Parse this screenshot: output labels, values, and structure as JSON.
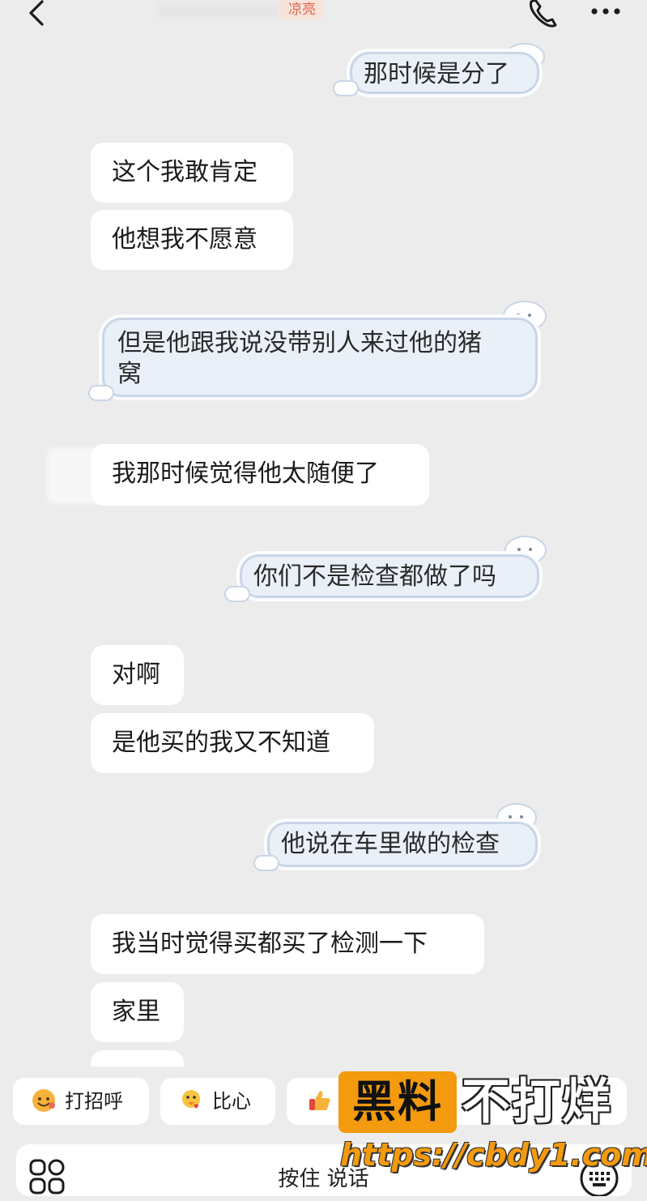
{
  "header": {
    "title_tag": "凉亮",
    "back_icon": "chevron-left-icon",
    "call_icon": "phone-icon",
    "more_icon": "more-dots-icon"
  },
  "messages": [
    {
      "side": "sent",
      "text": "那时候是分了"
    },
    {
      "side": "received",
      "text": "这个我敢肯定"
    },
    {
      "side": "received",
      "text": "他想我不愿意"
    },
    {
      "side": "sent",
      "text_line1": "但是他跟我说没带别人来过他的猪",
      "text_line2": "窝"
    },
    {
      "side": "received",
      "text": "我那时候觉得他太随便了"
    },
    {
      "side": "sent",
      "text": "你们不是检查都做了吗"
    },
    {
      "side": "received",
      "text": "对啊"
    },
    {
      "side": "received",
      "text": "是他买的我又不知道"
    },
    {
      "side": "sent",
      "text": "他说在车里做的检查"
    },
    {
      "side": "received",
      "text": "我当时觉得买都买了检测一下"
    },
    {
      "side": "received",
      "text": "家里"
    }
  ],
  "quick_replies": [
    {
      "label": "打招呼",
      "icon": "smile-emoji-icon"
    },
    {
      "label": "比心",
      "icon": "duck-heart-emoji-icon"
    },
    {
      "label": "",
      "icon": "thumbs-up-emoji-icon"
    }
  ],
  "input": {
    "hold_to_talk": "按住 说话",
    "apps_icon": "apps-grid-icon",
    "keyboard_icon": "keyboard-icon"
  },
  "watermark": {
    "box_text": "黑料",
    "text": "不打烊",
    "url": "https://cbdy1.com"
  },
  "colors": {
    "background": "#ececec",
    "received_bubble": "#ffffff",
    "sent_bubble": "#eaf0f8",
    "sent_border": "#c9d6e6",
    "title_tag": "#e0664a",
    "watermark_orange": "#f39a0e"
  }
}
